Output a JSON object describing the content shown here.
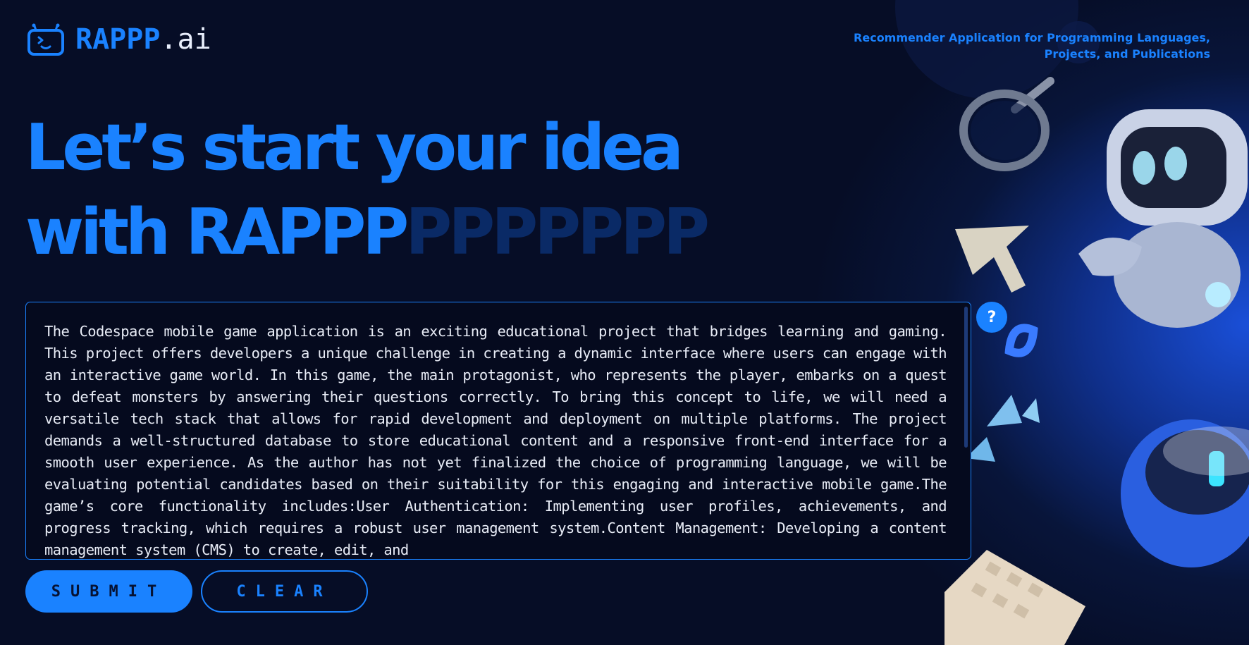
{
  "brand": {
    "name": "RAPPP",
    "suffix": ".ai",
    "tagline": "Recommender Application for Programming Languages, Projects, and Publications"
  },
  "hero": {
    "line1": "Let’s start your idea",
    "line2_main": "with RAPPP",
    "line2_fade": "PPPPPPP"
  },
  "input": {
    "text": "The Codespace mobile game application is an exciting educational project that bridges learning and gaming. This project offers developers a unique challenge in creating a dynamic interface where users can engage with an interactive game world. In this game, the main protagonist, who represents the player, embarks on a quest to defeat monsters by answering their questions correctly. To bring this concept to life, we will need a versatile tech stack that allows for rapid development and deployment on multiple platforms. The project demands a well-structured database to store educational content and a responsive front-end interface for a smooth user experience. As the author has not yet finalized the choice of programming language, we will be evaluating potential candidates based on their suitability for this engaging and interactive mobile game.The game’s core functionality includes:User Authentication: Implementing user profiles, achievements, and progress tracking, which requires a robust user management system.Content Management: Developing a content management system (CMS) to create, edit, and"
  },
  "help": {
    "label": "?"
  },
  "actions": {
    "submit_label": "SUBMIT",
    "clear_label": "CLEAR"
  },
  "colors": {
    "accent": "#1a82ff",
    "background": "#060d26",
    "text": "#e8ecf6"
  }
}
